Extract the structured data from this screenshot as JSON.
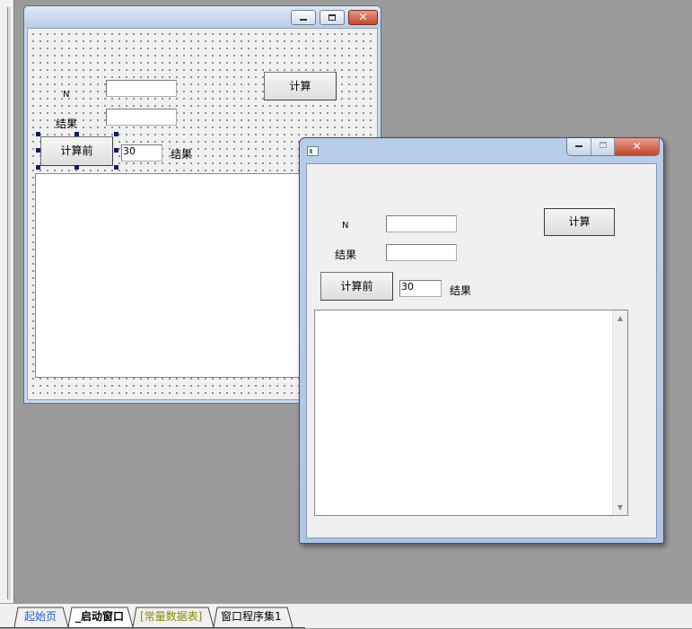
{
  "designer": {
    "n_label": "N",
    "result_label": "结果",
    "calc_button": "计算",
    "calc_before_button": "计算前",
    "count_value": "30",
    "result_label2": "结果"
  },
  "running": {
    "n_label": "N",
    "result_label": "结果",
    "calc_button": "计算",
    "calc_before_button": "计算前",
    "count_value": "30",
    "result_label2": "结果"
  },
  "tabs": [
    {
      "label": "起始页",
      "color": "#1a5fd0"
    },
    {
      "label": "_启动窗口",
      "color": "#000000"
    },
    {
      "label": "[常量数据表]",
      "color": "#8a8a00"
    },
    {
      "label": "窗口程序集1",
      "color": "#000000"
    }
  ],
  "colors": {
    "workspace": "#9b9b9b",
    "selection_handles": "#0a1e6e"
  }
}
